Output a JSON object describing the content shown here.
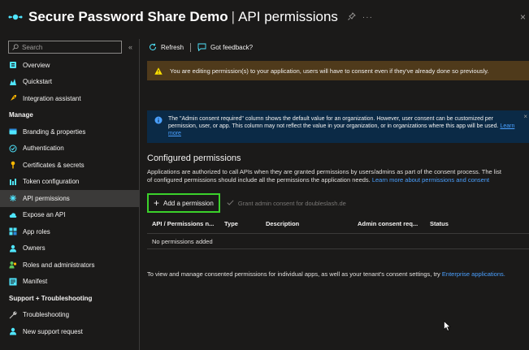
{
  "header": {
    "app_name": "Secure Password Share Demo",
    "separator": "|",
    "page_name": "API permissions",
    "more": "···",
    "close": "×"
  },
  "sidebar": {
    "search_placeholder": "Search",
    "collapse": "«",
    "top_items": [
      {
        "label": "Overview",
        "icon": "overview-icon",
        "color": "#50e6ff"
      },
      {
        "label": "Quickstart",
        "icon": "quickstart-icon",
        "color": "#50e6ff"
      },
      {
        "label": "Integration assistant",
        "icon": "rocket-icon",
        "color": "#ffb900"
      }
    ],
    "manage_label": "Manage",
    "manage_items": [
      {
        "label": "Branding & properties",
        "icon": "branding-icon",
        "color": "#50e6ff"
      },
      {
        "label": "Authentication",
        "icon": "authentication-icon",
        "color": "#50e6ff"
      },
      {
        "label": "Certificates & secrets",
        "icon": "key-icon",
        "color": "#ffb900"
      },
      {
        "label": "Token configuration",
        "icon": "token-icon",
        "color": "#50e6ff"
      },
      {
        "label": "API permissions",
        "icon": "api-permissions-icon",
        "color": "#50e6ff",
        "active": true
      },
      {
        "label": "Expose an API",
        "icon": "cloud-icon",
        "color": "#50e6ff"
      },
      {
        "label": "App roles",
        "icon": "app-roles-icon",
        "color": "#50e6ff"
      },
      {
        "label": "Owners",
        "icon": "owners-icon",
        "color": "#50e6ff"
      },
      {
        "label": "Roles and administrators",
        "icon": "roles-icon",
        "color": "#5ec75e"
      },
      {
        "label": "Manifest",
        "icon": "manifest-icon",
        "color": "#50e6ff"
      }
    ],
    "support_label": "Support + Troubleshooting",
    "support_items": [
      {
        "label": "Troubleshooting",
        "icon": "wrench-icon",
        "color": "#c8c6c4"
      },
      {
        "label": "New support request",
        "icon": "support-icon",
        "color": "#50e6ff"
      }
    ]
  },
  "toolbar": {
    "refresh_label": "Refresh",
    "feedback_label": "Got feedback?"
  },
  "warning": {
    "text": "You are editing permission(s) to your application, users will have to consent even if they've already done so previously."
  },
  "info": {
    "text": "The \"Admin consent required\" column shows the default value for an organization. However, user consent can be customized per permission, user, or app. This column may not reflect the value in your organization, or in organizations where this app will be used.",
    "link": "Learn more"
  },
  "configured": {
    "title": "Configured permissions",
    "line1": "Applications are authorized to call APIs when they are granted permissions by users/admins as part of the consent process. The list",
    "line2": "of configured permissions should include all the permissions the application needs.",
    "link": "Learn more about permissions and consent"
  },
  "actions": {
    "add_label": "Add a permission",
    "grant_label": "Grant admin consent for doubleslash.de"
  },
  "table": {
    "columns": [
      "API / Permissions n...",
      "Type",
      "Description",
      "Admin consent req...",
      "Status"
    ],
    "empty_text": "No permissions added"
  },
  "footer": {
    "text": "To view and manage consented permissions for individual apps, as well as your tenant's consent settings, try",
    "link": "Enterprise applications."
  },
  "colors": {
    "background": "#1b1a19",
    "warning_bg": "#4f3a1b",
    "info_bg": "#0b2a46",
    "link": "#4aa0ff",
    "highlight": "#3bd12b"
  }
}
